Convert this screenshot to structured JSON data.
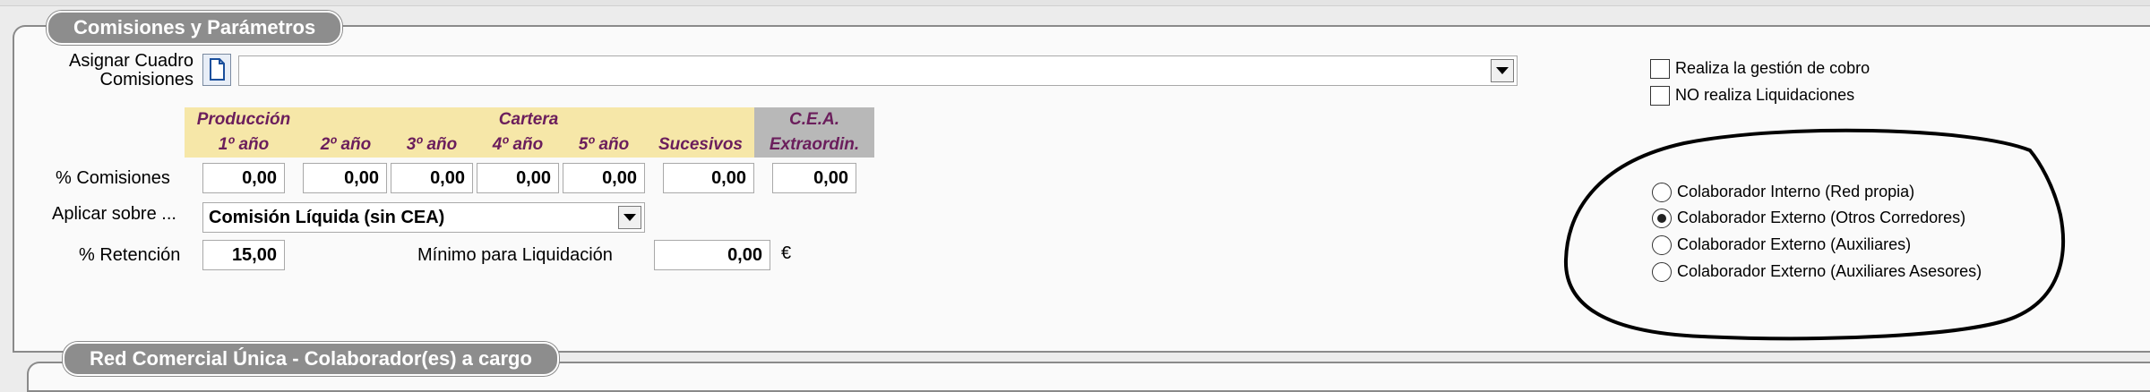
{
  "section1": {
    "title": "Comisiones y Parámetros"
  },
  "assign": {
    "label_line1": "Asignar Cuadro",
    "label_line2": "Comisiones",
    "value": ""
  },
  "table": {
    "headers_row1": {
      "produccion": "Producción",
      "cartera": "Cartera",
      "cea": "C.E.A."
    },
    "headers_row2": [
      "1º año",
      "2º año",
      "3º año",
      "4º año",
      "5º año",
      "Sucesivos",
      "Extraordin."
    ],
    "row_label": "% Comisiones",
    "values": [
      "0,00",
      "0,00",
      "0,00",
      "0,00",
      "0,00",
      "0,00",
      "0,00"
    ]
  },
  "aplicar": {
    "label": "Aplicar sobre ...",
    "value": "Comisión Líquida (sin CEA)"
  },
  "retencion": {
    "label": "% Retención",
    "value": "15,00"
  },
  "minimo": {
    "label": "Mínimo para Liquidación",
    "value": "0,00",
    "unit": "€"
  },
  "checks": [
    {
      "label": "Realiza la gestión de cobro",
      "checked": false
    },
    {
      "label": "NO realiza Liquidaciones",
      "checked": false
    }
  ],
  "radios": [
    {
      "label": "Colaborador Interno (Red propia)",
      "selected": false
    },
    {
      "label": "Colaborador Externo (Otros Corredores)",
      "selected": true
    },
    {
      "label": "Colaborador Externo (Auxiliares)",
      "selected": false
    },
    {
      "label": "Colaborador Externo (Auxiliares Asesores)",
      "selected": false
    }
  ],
  "section2": {
    "title": "Red Comercial Única - Colaborador(es) a cargo"
  },
  "colors": {
    "header_yellow": "#f6e7a8",
    "header_gray": "#b8b8b8",
    "header_text": "#6b1e5c",
    "legend_bg": "#8d8d8d"
  }
}
